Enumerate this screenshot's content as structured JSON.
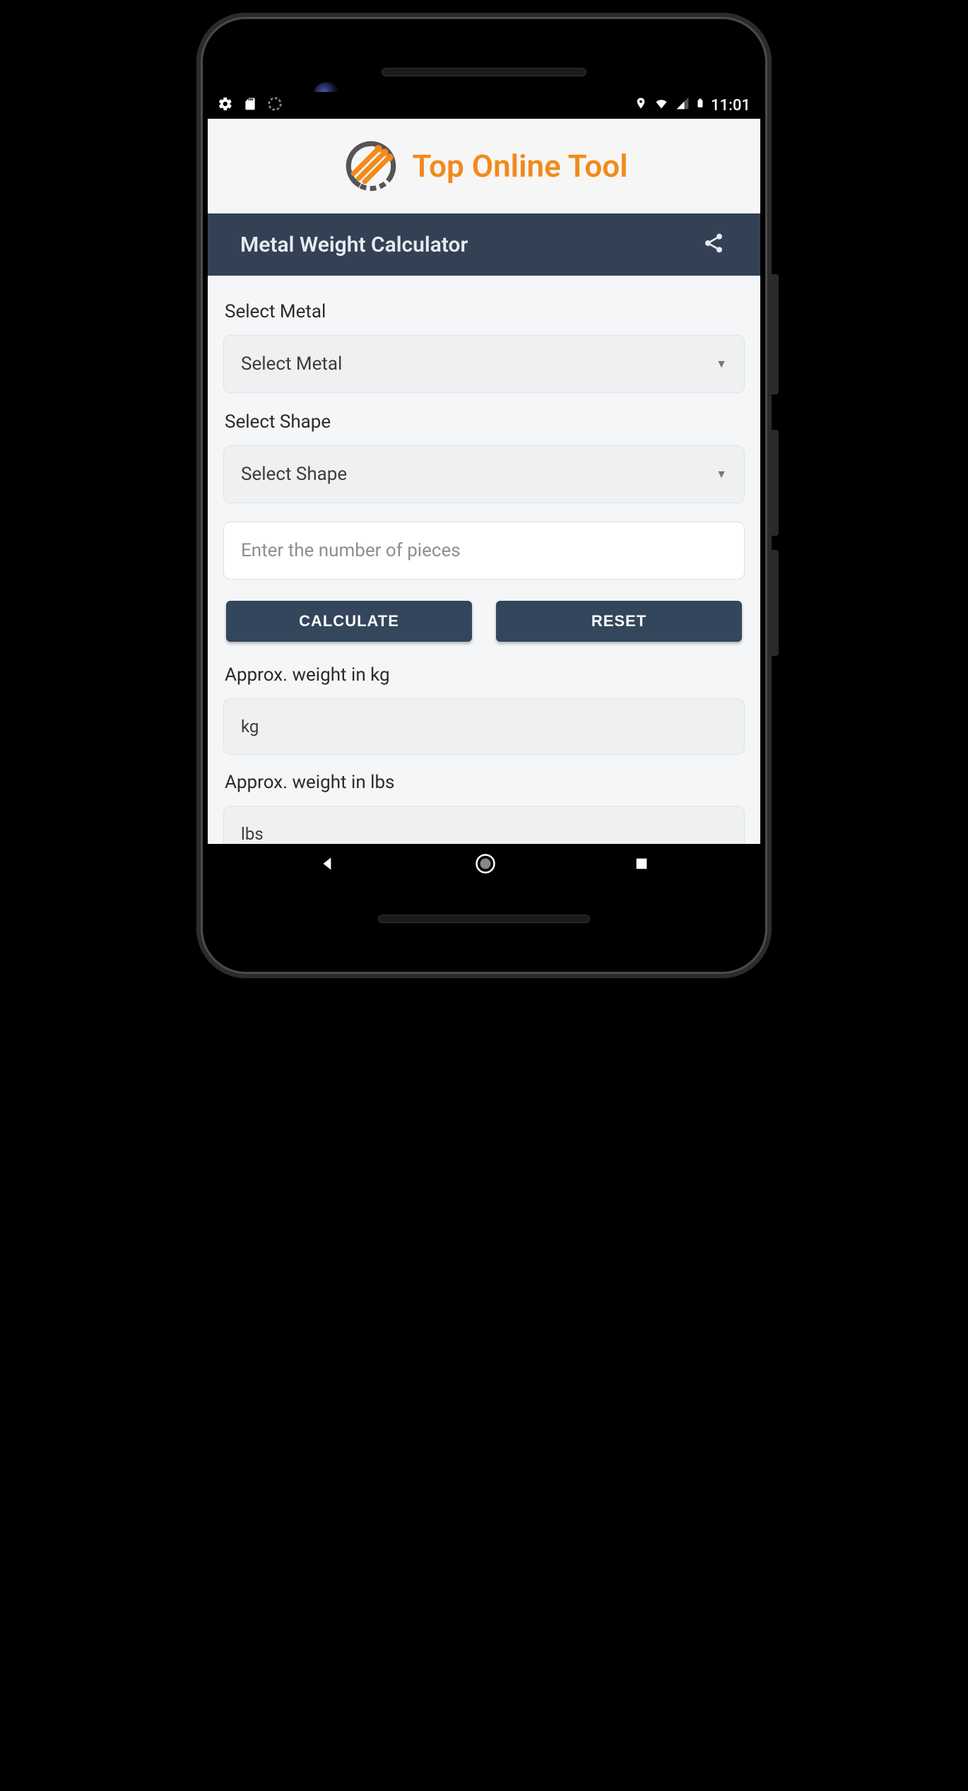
{
  "status_bar": {
    "time": "11:01",
    "icons": {
      "settings": "gear-icon",
      "sd": "sd-card-icon",
      "spinner": "spinner-icon",
      "location": "location-icon",
      "wifi": "wifi-icon",
      "cellular": "cellular-icon",
      "battery": "battery-icon"
    }
  },
  "header": {
    "app_name": "Top Online Tool",
    "logo": "gear-logo"
  },
  "title_bar": {
    "title": "Metal Weight Calculator",
    "share_icon": "share-icon"
  },
  "form": {
    "metal": {
      "label": "Select Metal",
      "selected": "Select Metal"
    },
    "shape": {
      "label": "Select Shape",
      "selected": "Select Shape"
    },
    "pieces": {
      "placeholder": "Enter the number of pieces",
      "value": ""
    },
    "calculate_label": "CALCULATE",
    "reset_label": "RESET"
  },
  "results": {
    "kg_label": "Approx. weight in kg",
    "kg_value": "kg",
    "lbs_label": "Approx. weight in lbs",
    "lbs_value": "lbs"
  },
  "nav": {
    "back": "back-icon",
    "home": "home-icon",
    "recent": "recent-icon"
  },
  "colors": {
    "accent": "#f28a1b",
    "title_bg": "#344154",
    "button_bg": "#33465b"
  }
}
